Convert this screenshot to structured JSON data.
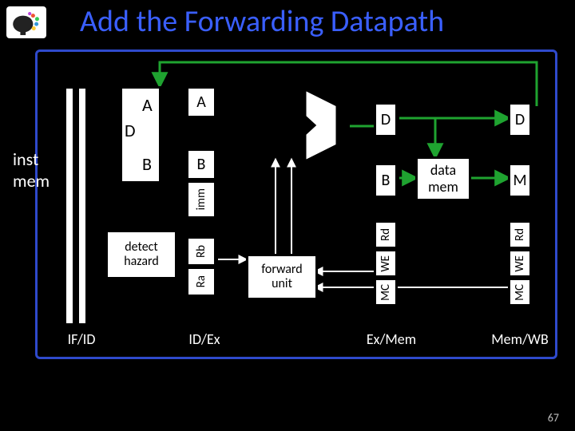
{
  "title": "Add the Forwarding Datapath",
  "stages": {
    "if_id": "IF/ID",
    "id_ex": "ID/Ex",
    "ex_mem": "Ex/Mem",
    "mem_wb": "Mem/WB"
  },
  "labels": {
    "inst_mem_l1": "inst",
    "inst_mem_l2": "mem",
    "data_mem_l1": "data",
    "data_mem_l2": "mem",
    "A_regD": "A",
    "B_regD": "B",
    "D_regD": "D",
    "A_ex": "A",
    "B_ex": "B",
    "imm": "imm",
    "Rb": "Rb",
    "Ra": "Ra",
    "detect_l1": "detect",
    "detect_l2": "hazard",
    "forward_l1": "forward",
    "forward_l2": "unit",
    "D_exmem": "D",
    "B_exmem": "B",
    "Rd_exmem": "Rd",
    "WE_exmem": "WE",
    "MC_exmem": "MC",
    "D_memwb": "D",
    "M_memwb": "M",
    "Rd_memwb": "Rd",
    "WE_memwb": "WE",
    "MC_memwb": "MC"
  },
  "page_number": "67"
}
